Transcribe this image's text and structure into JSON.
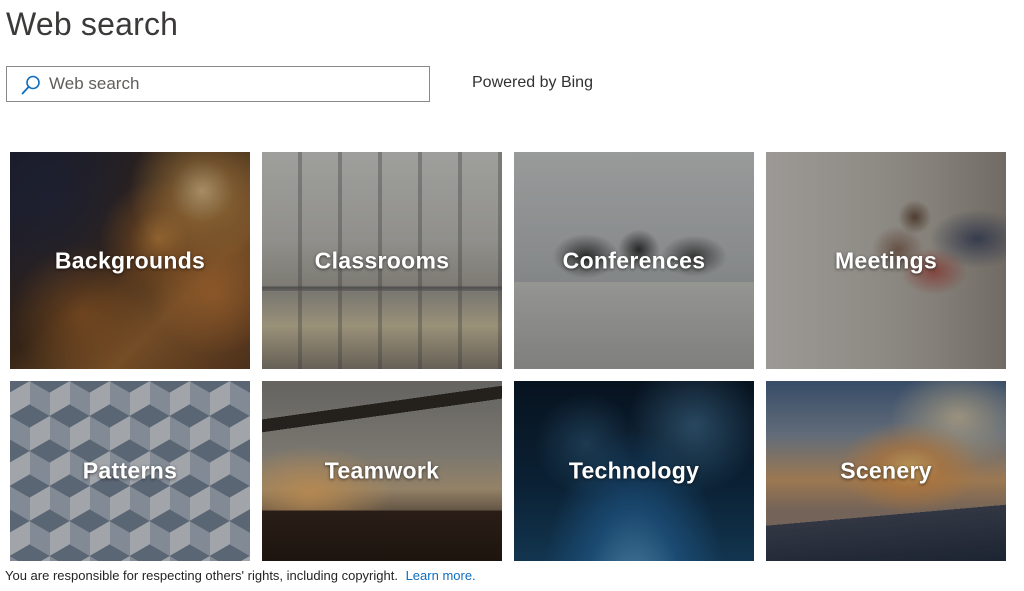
{
  "header": {
    "title": "Web search"
  },
  "search": {
    "placeholder": "Web search",
    "value": "",
    "powered_by": "Powered by Bing",
    "icon": "search-icon"
  },
  "tiles": [
    {
      "label": "Backgrounds"
    },
    {
      "label": "Classrooms"
    },
    {
      "label": "Conferences"
    },
    {
      "label": "Meetings"
    },
    {
      "label": "Patterns"
    },
    {
      "label": "Teamwork"
    },
    {
      "label": "Technology"
    },
    {
      "label": "Scenery"
    }
  ],
  "footer": {
    "notice": "You are responsible for respecting others' rights, including copyright.",
    "link_label": "Learn more."
  },
  "colors": {
    "link": "#106ebe",
    "search_icon": "#106ebe",
    "tile_text": "#ffffff"
  }
}
